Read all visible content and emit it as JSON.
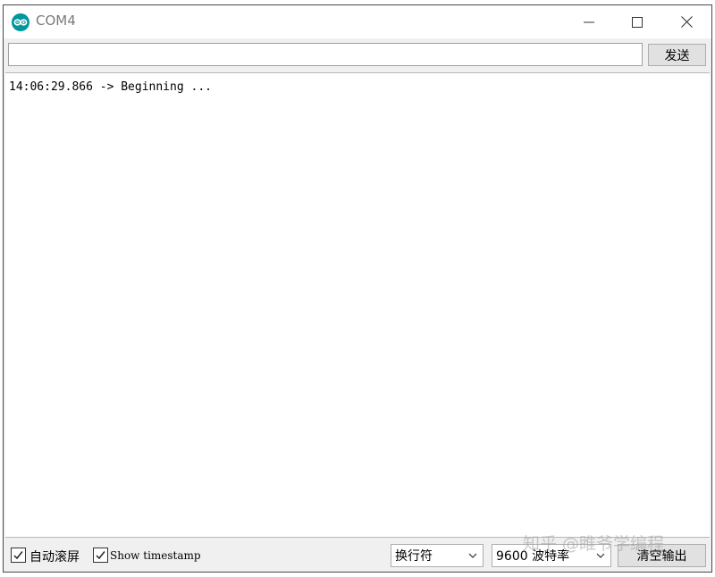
{
  "window": {
    "title": "COM4"
  },
  "input": {
    "value": "",
    "send_label": "发送"
  },
  "output": {
    "lines": [
      "14:06:29.866 -> Beginning ..."
    ]
  },
  "status": {
    "autoscroll": {
      "label": "自动滚屏",
      "checked": true
    },
    "timestamp": {
      "label": "Show timestamp",
      "checked": true
    },
    "line_ending": "换行符",
    "baud_rate": "9600 波特率",
    "clear_label": "清空输出"
  },
  "watermark": "知乎 @睢爷学编程",
  "colors": {
    "accent": "#00979c"
  }
}
